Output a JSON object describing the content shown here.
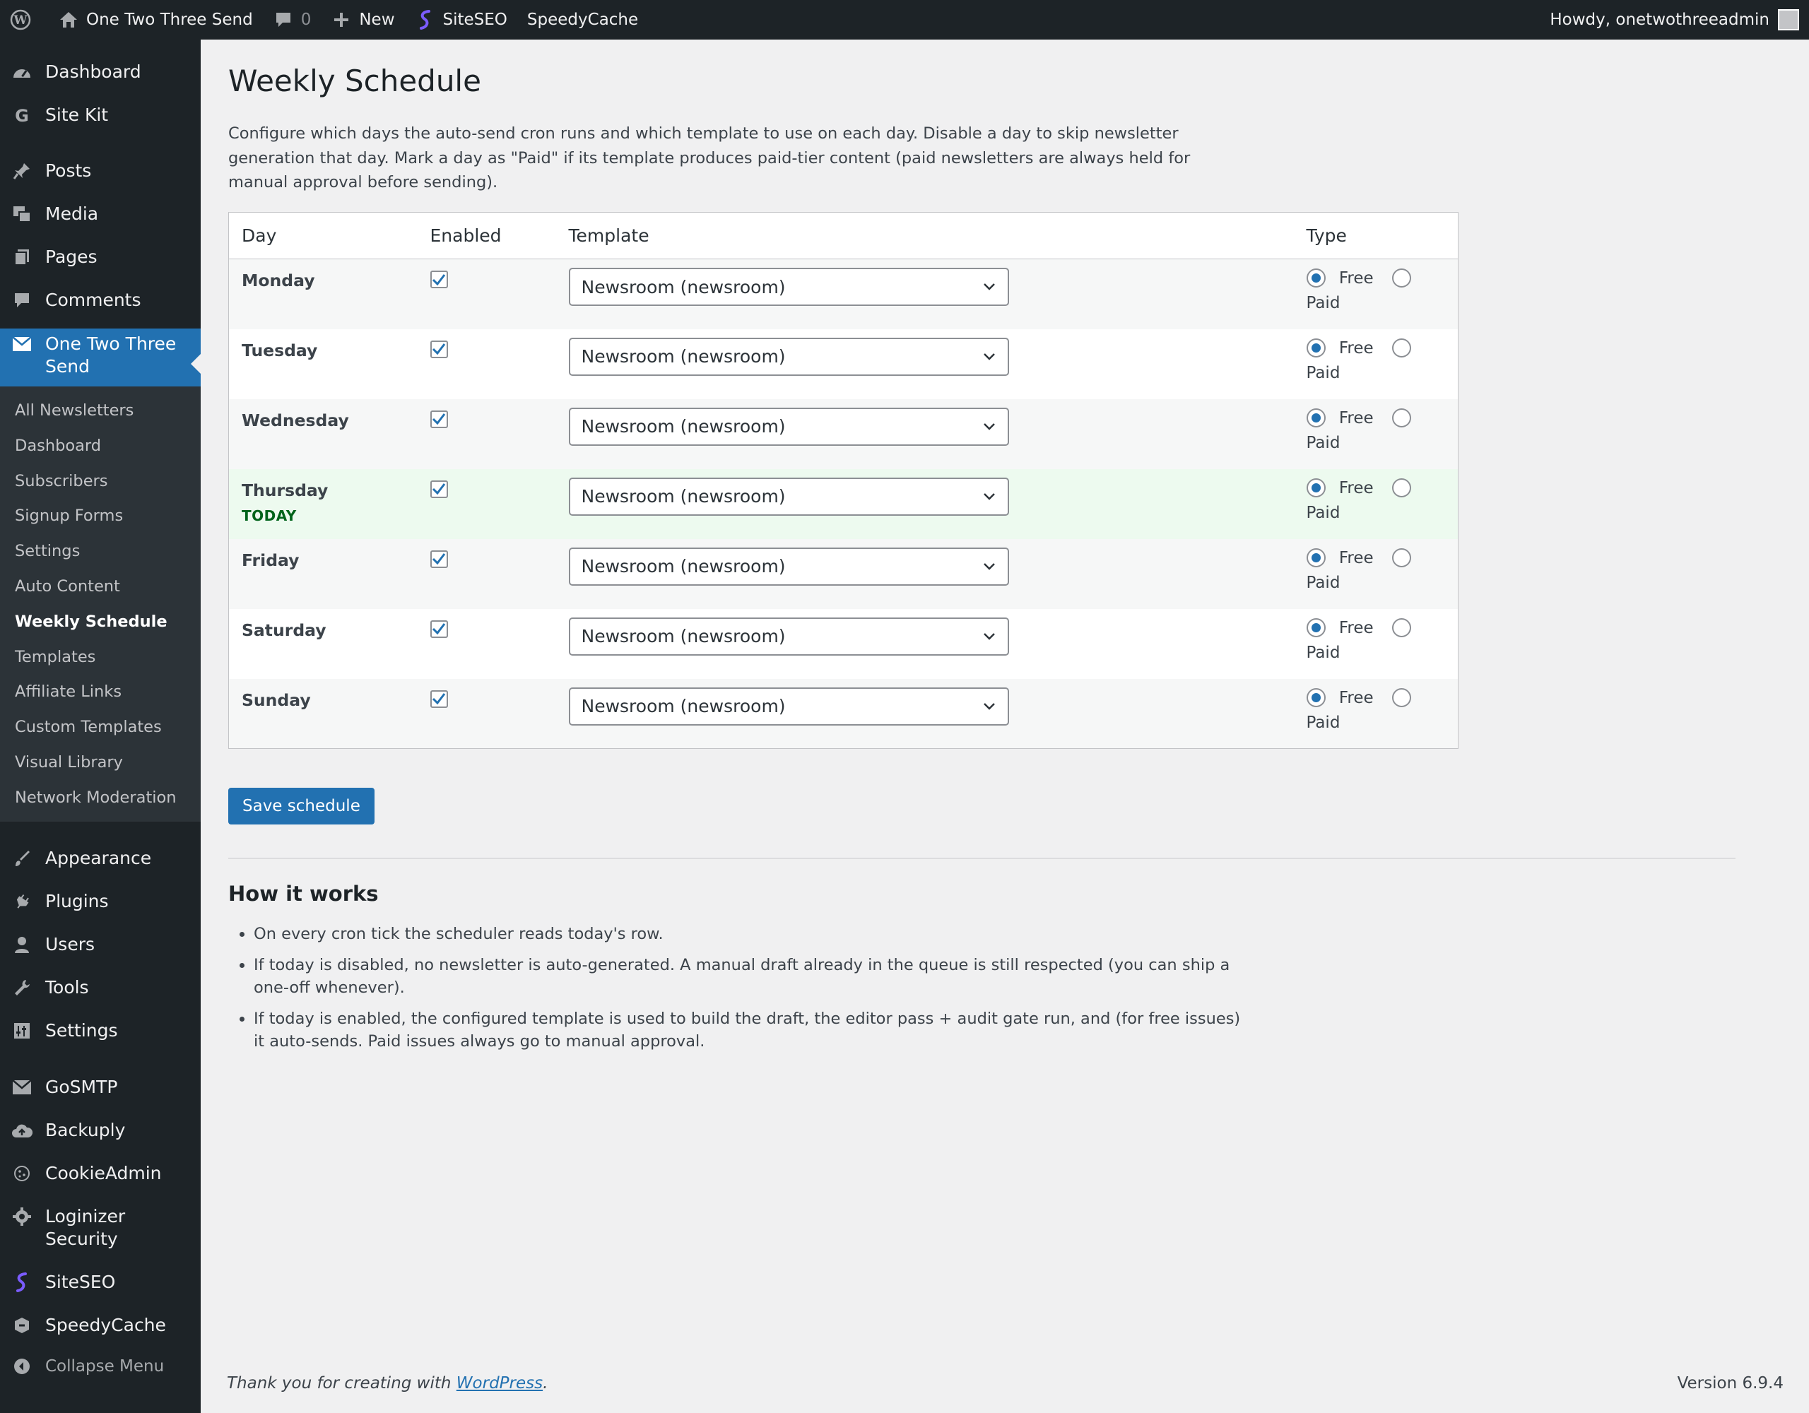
{
  "adminbar": {
    "site_name": "One Two Three Send",
    "comments_count": "0",
    "new_label": "New",
    "siteseo_label": "SiteSEO",
    "speedycache_label": "SpeedyCache",
    "howdy": "Howdy, onetwothreeadmin"
  },
  "sidebar": {
    "top_items": [
      {
        "label": "Dashboard",
        "icon": "dashboard-icon"
      },
      {
        "label": "Site Kit",
        "icon": "google-icon"
      }
    ],
    "content_items": [
      {
        "label": "Posts",
        "icon": "pin-icon"
      },
      {
        "label": "Media",
        "icon": "media-icon"
      },
      {
        "label": "Pages",
        "icon": "pages-icon"
      },
      {
        "label": "Comments",
        "icon": "comment-icon"
      }
    ],
    "active_item": {
      "label": "One Two Three Send",
      "icon": "envelope-icon"
    },
    "submenu": [
      "All Newsletters",
      "Dashboard",
      "Subscribers",
      "Signup Forms",
      "Settings",
      "Auto Content",
      "Weekly Schedule",
      "Templates",
      "Affiliate Links",
      "Custom Templates",
      "Visual Library",
      "Network Moderation"
    ],
    "current_sub": "Weekly Schedule",
    "admin_items": [
      {
        "label": "Appearance",
        "icon": "brush-icon"
      },
      {
        "label": "Plugins",
        "icon": "plugin-icon"
      },
      {
        "label": "Users",
        "icon": "user-icon"
      },
      {
        "label": "Tools",
        "icon": "wrench-icon"
      },
      {
        "label": "Settings",
        "icon": "sliders-icon"
      }
    ],
    "plugin_items": [
      {
        "label": "GoSMTP",
        "icon": "envelope-icon"
      },
      {
        "label": "Backuply",
        "icon": "cloud-upload-icon"
      },
      {
        "label": "CookieAdmin",
        "icon": "cookie-icon"
      },
      {
        "label": "Loginizer Security",
        "icon": "gear-icon"
      },
      {
        "label": "SiteSEO",
        "icon": "siteseo-icon"
      },
      {
        "label": "SpeedyCache",
        "icon": "speedycache-icon"
      }
    ],
    "collapse_label": "Collapse Menu"
  },
  "page": {
    "title": "Weekly Schedule",
    "intro": "Configure which days the auto-send cron runs and which template to use on each day. Disable a day to skip newsletter generation that day. Mark a day as \"Paid\" if its template produces paid-tier content (paid newsletters are always held for manual approval before sending).",
    "columns": [
      "Day",
      "Enabled",
      "Template",
      "Type"
    ],
    "rows": [
      {
        "day": "Monday",
        "enabled": true,
        "template": "Newsroom (newsroom)",
        "type": "Free",
        "today": false
      },
      {
        "day": "Tuesday",
        "enabled": true,
        "template": "Newsroom (newsroom)",
        "type": "Free",
        "today": false
      },
      {
        "day": "Wednesday",
        "enabled": true,
        "template": "Newsroom (newsroom)",
        "type": "Free",
        "today": false
      },
      {
        "day": "Thursday",
        "enabled": true,
        "template": "Newsroom (newsroom)",
        "type": "Free",
        "today": true
      },
      {
        "day": "Friday",
        "enabled": true,
        "template": "Newsroom (newsroom)",
        "type": "Free",
        "today": false
      },
      {
        "day": "Saturday",
        "enabled": true,
        "template": "Newsroom (newsroom)",
        "type": "Free",
        "today": false
      },
      {
        "day": "Sunday",
        "enabled": true,
        "template": "Newsroom (newsroom)",
        "type": "Free",
        "today": false
      }
    ],
    "today_badge": "TODAY",
    "free_label": "Free",
    "paid_label": "Paid",
    "save_label": "Save schedule",
    "how_title": "How it works",
    "how_items": [
      "On every cron tick the scheduler reads today's row.",
      "If today is disabled, no newsletter is auto-generated. A manual draft already in the queue is still respected (you can ship a one-off whenever).",
      "If today is enabled, the configured template is used to build the draft, the editor pass + audit gate run, and (for free issues) it auto-sends. Paid issues always go to manual approval."
    ]
  },
  "footer": {
    "thanks_prefix": "Thank you for creating with ",
    "wp_link": "WordPress",
    "thanks_suffix": ".",
    "version": "Version 6.9.4"
  },
  "colors": {
    "accent": "#2271b1",
    "adminbar_bg": "#1d2327",
    "today_row": "#edfaef",
    "today_text": "#00631a"
  }
}
